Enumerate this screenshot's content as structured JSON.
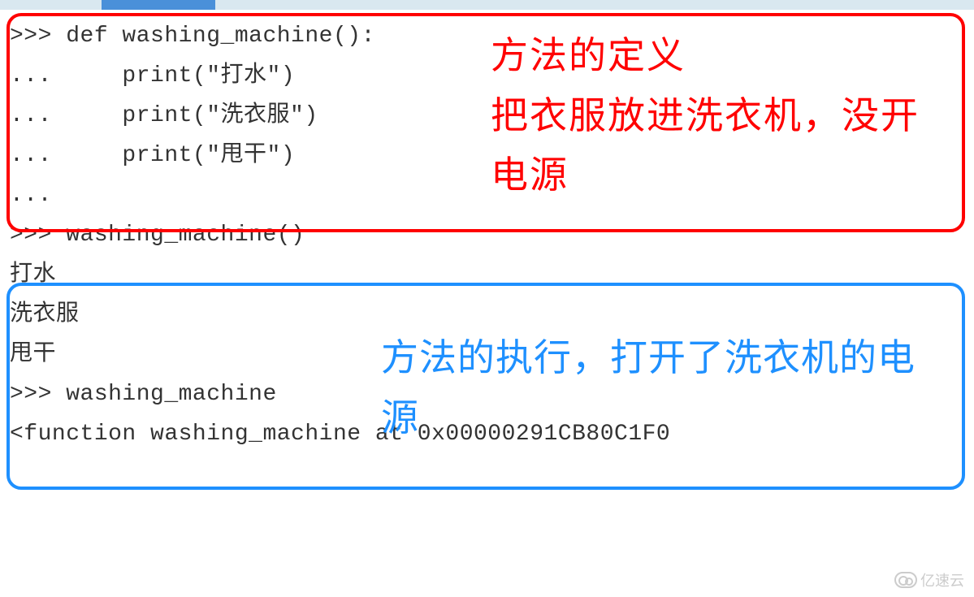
{
  "code": {
    "line1": ">>> def washing_machine():",
    "line2": "...     print(\"打水\")",
    "line3": "...     print(\"洗衣服\")",
    "line4": "...     print(\"甩干\")",
    "line5": "...",
    "line6": ">>> washing_machine()",
    "line7": "打水",
    "line8": "洗衣服",
    "line9": "甩干",
    "line10": ">>> washing_machine",
    "line11": "<function washing_machine at 0x00000291CB80C1F0"
  },
  "annotations": {
    "red": "方法的定义\n把衣服放进洗衣机，没开电源",
    "blue": "方法的执行，打开了洗衣机的电源"
  },
  "watermark": {
    "text": "亿速云"
  }
}
